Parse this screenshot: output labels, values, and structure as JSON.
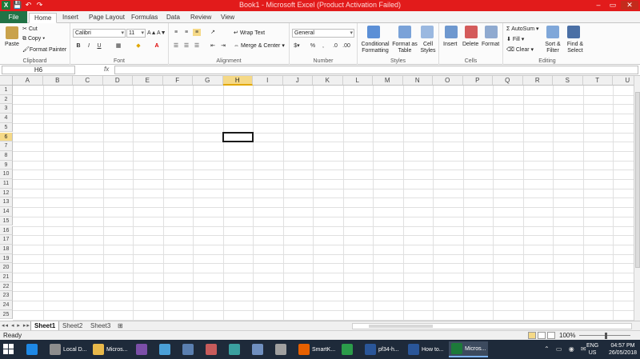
{
  "window": {
    "title": "Book1 - Microsoft Excel (Product Activation Failed)",
    "qat": [
      "💾",
      "↶",
      "↷"
    ]
  },
  "tabs": [
    "File",
    "Home",
    "Insert",
    "Page Layout",
    "Formulas",
    "Data",
    "Review",
    "View"
  ],
  "ribbon": {
    "clipboard": {
      "label": "Clipboard",
      "paste": "Paste",
      "cut": "Cut",
      "copy": "Copy",
      "format_painter": "Format Painter"
    },
    "font": {
      "label": "Font",
      "name": "Calibri",
      "size": "11",
      "bold": "B",
      "italic": "I",
      "underline": "U"
    },
    "alignment": {
      "label": "Alignment",
      "wrap": "Wrap Text",
      "merge": "Merge & Center"
    },
    "number": {
      "label": "Number",
      "format": "General",
      "percent": "%",
      "comma": ","
    },
    "styles": {
      "label": "Styles",
      "conditional": "Conditional Formatting",
      "format_table": "Format as Table",
      "cell_styles": "Cell Styles"
    },
    "cells": {
      "label": "Cells",
      "insert": "Insert",
      "delete": "Delete",
      "format": "Format"
    },
    "editing": {
      "label": "Editing",
      "autosum": "AutoSum",
      "fill": "Fill",
      "clear": "Clear",
      "sort": "Sort & Filter",
      "find": "Find & Select"
    }
  },
  "formula_bar": {
    "name_box": "H6",
    "fx": "fx",
    "value": ""
  },
  "columns": [
    "A",
    "B",
    "C",
    "D",
    "E",
    "F",
    "G",
    "H",
    "I",
    "J",
    "K",
    "L",
    "M",
    "N",
    "O",
    "P",
    "Q",
    "R",
    "S",
    "T",
    "U"
  ],
  "rows": [
    "1",
    "2",
    "3",
    "4",
    "5",
    "6",
    "7",
    "8",
    "9",
    "10",
    "11",
    "12",
    "13",
    "14",
    "15",
    "16",
    "17",
    "18",
    "19",
    "20",
    "21",
    "22",
    "23",
    "24",
    "25"
  ],
  "active_cell": {
    "column": "H",
    "row": "6"
  },
  "sheets": [
    "Sheet1",
    "Sheet2",
    "Sheet3"
  ],
  "status": {
    "ready": "Ready",
    "zoom": "100%"
  },
  "taskbar": {
    "items": [
      {
        "icon": "ie-icon",
        "label": ""
      },
      {
        "icon": "drive-icon",
        "label": "Local D..."
      },
      {
        "icon": "folder-icon",
        "label": "Micros..."
      },
      {
        "icon": "vs-icon",
        "label": ""
      },
      {
        "icon": "app-icon",
        "label": ""
      },
      {
        "icon": "app2-icon",
        "label": ""
      },
      {
        "icon": "app3-icon",
        "label": ""
      },
      {
        "icon": "app4-icon",
        "label": ""
      },
      {
        "icon": "app5-icon",
        "label": ""
      },
      {
        "icon": "tools-icon",
        "label": ""
      },
      {
        "icon": "firefox-icon",
        "label": "SmartK..."
      },
      {
        "icon": "chrome-icon",
        "label": ""
      },
      {
        "icon": "word-icon",
        "label": "pf34-h..."
      },
      {
        "icon": "word2-icon",
        "label": "How to..."
      },
      {
        "icon": "excel-icon",
        "label": "Micros..."
      }
    ],
    "lang": "ENG",
    "region": "US",
    "time": "04:57 PM",
    "date": "26/05/2018"
  }
}
